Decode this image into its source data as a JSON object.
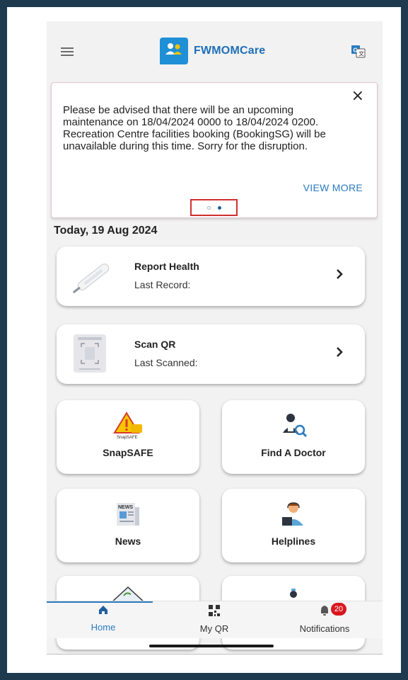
{
  "header": {
    "app_title": "FWMOMCare",
    "menu_icon": "hamburger-icon",
    "translate_icon": "translate-icon"
  },
  "announcement": {
    "text": "Please be advised that there will be an upcoming maintenance on 18/04/2024 0000 to 18/04/2024 0200. Recreation Centre facilities booking (BookingSG) will be unavailable during this time. Sorry for the disruption.",
    "close_label": "×",
    "view_more_label": "VIEW MORE",
    "page_count": 2,
    "active_page": 2
  },
  "date_heading": "Today, 19 Aug 2024",
  "cards": {
    "report_health": {
      "title": "Report Health",
      "subtitle": "Last Record:",
      "icon": "thermometer-icon"
    },
    "scan_qr": {
      "title": "Scan QR",
      "subtitle": "Last Scanned:",
      "icon": "qr-scan-icon"
    }
  },
  "tiles": [
    {
      "label": "SnapSAFE",
      "icon": "snapsafe-warning-icon",
      "icon_caption": "SnapSAFE"
    },
    {
      "label": "Find A Doctor",
      "icon": "find-doctor-icon"
    },
    {
      "label": "News",
      "icon": "news-icon",
      "icon_caption": "NEWS"
    },
    {
      "label": "Helplines",
      "icon": "helpline-agent-icon"
    }
  ],
  "bottom_nav": {
    "items": [
      {
        "label": "Home",
        "icon": "home-icon",
        "active": true
      },
      {
        "label": "My QR",
        "icon": "qr-code-icon",
        "active": false
      },
      {
        "label": "Notifications",
        "icon": "bell-icon",
        "active": false,
        "badge": "20"
      }
    ]
  },
  "colors": {
    "accent": "#2b7bbf",
    "brand_blue": "#1f8fd6",
    "frame": "#1e3a4f",
    "badge_red": "#d9181e",
    "highlight_box": "#d03030"
  }
}
